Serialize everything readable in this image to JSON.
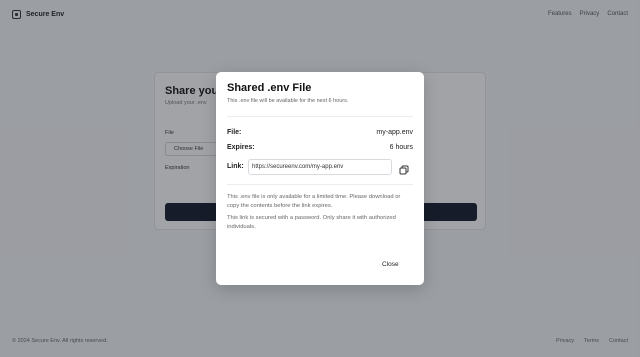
{
  "header": {
    "brand": "Secure Env",
    "nav": [
      "Features",
      "Privacy",
      "Contact"
    ]
  },
  "background_card": {
    "title": "Share your",
    "subtitle": "Upload your .env",
    "file_label": "File",
    "choose_button": "Choose File",
    "expiration_label": "Expiration"
  },
  "footer": {
    "copyright": "© 2024 Secure Env. All rights reserved.",
    "links": [
      "Privacy",
      "Terms",
      "Contact"
    ]
  },
  "modal": {
    "title": "Shared .env File",
    "subtitle": "This .env file will be available for the next 6 hours.",
    "file_label": "File:",
    "file_value": "my-app.env",
    "expires_label": "Expires:",
    "expires_value": "6 hours",
    "link_label": "Link:",
    "link_value": "https://secureenv.com/my-app.env",
    "note1": "This .env file is only available for a limited time. Please download or copy the contents before the link expires.",
    "note2": "This link is secured with a password. Only share it with authorized individuals.",
    "close_label": "Close"
  },
  "icons": {
    "brand": "lock-box-icon",
    "copy": "copy-icon"
  },
  "colors": {
    "primary_button": "#111827",
    "overlay": "rgba(30,35,45,0.42)"
  }
}
